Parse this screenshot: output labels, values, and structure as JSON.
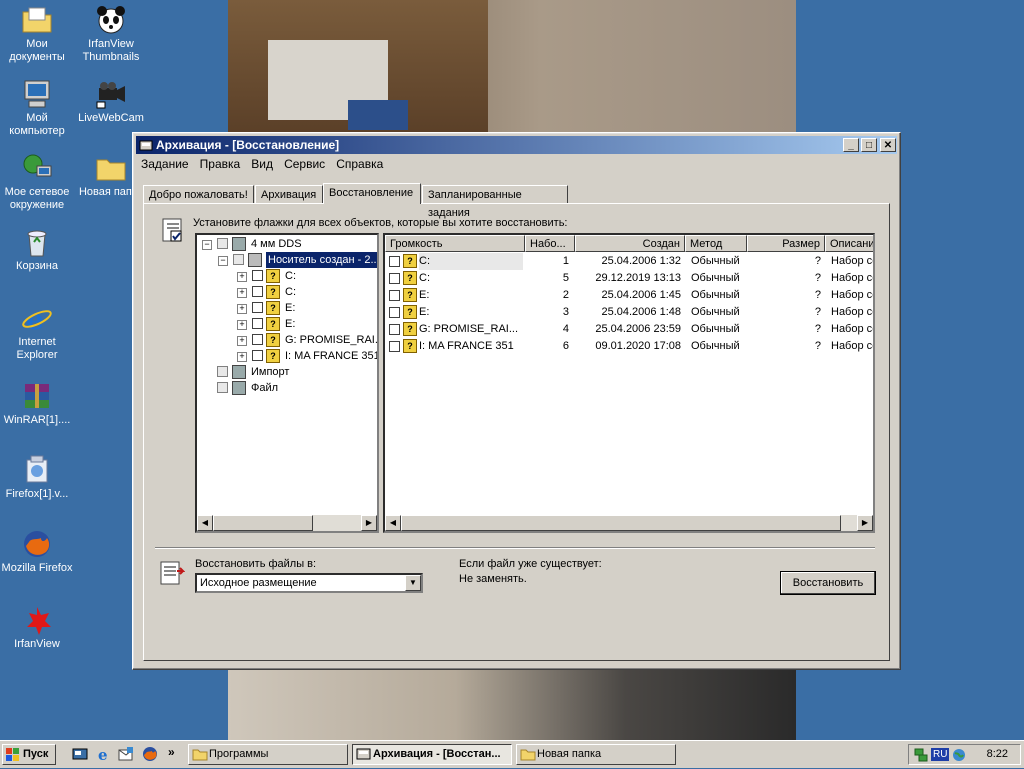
{
  "desktop": {
    "icons": [
      {
        "label": "Мои документы",
        "icon": "folder-documents-icon"
      },
      {
        "label": "IrfanView Thumbnails",
        "icon": "panda-icon"
      },
      {
        "label": "Мой компьютер",
        "icon": "computer-icon"
      },
      {
        "label": "LiveWebCam",
        "icon": "camera-icon"
      },
      {
        "label": "Мое сетевое окружение",
        "icon": "network-icon"
      },
      {
        "label": "Новая папка",
        "icon": "folder-icon"
      },
      {
        "label": "Корзина",
        "icon": "recycle-bin-icon"
      },
      {
        "label": "Internet Explorer",
        "icon": "ie-icon"
      },
      {
        "label": "WinRAR[1]....",
        "icon": "winrar-icon"
      },
      {
        "label": "Firefox[1].v...",
        "icon": "installer-icon"
      },
      {
        "label": "Mozilla Firefox",
        "icon": "firefox-icon"
      },
      {
        "label": "IrfanView",
        "icon": "irfanview-icon"
      }
    ]
  },
  "window": {
    "title": "Архивация - [Восстановление]",
    "menu": [
      "Задание",
      "Правка",
      "Вид",
      "Сервис",
      "Справка"
    ],
    "tabs": [
      "Добро пожаловать!",
      "Архивация",
      "Восстановление",
      "Запланированные задания"
    ],
    "active_tab": "Восстановление",
    "instruction": "Установите флажки для всех объектов, которые вы хотите восстановить:",
    "tree": [
      {
        "label": "4 мм DDS",
        "level": 0,
        "expand": "−",
        "type": "tape"
      },
      {
        "label": "Носитель создан - 2...",
        "level": 1,
        "expand": "−",
        "type": "media",
        "selected": true
      },
      {
        "label": "C:",
        "level": 2,
        "expand": "+",
        "type": "drive"
      },
      {
        "label": "C:",
        "level": 2,
        "expand": "+",
        "type": "drive"
      },
      {
        "label": "E:",
        "level": 2,
        "expand": "+",
        "type": "drive"
      },
      {
        "label": "E:",
        "level": 2,
        "expand": "+",
        "type": "drive"
      },
      {
        "label": "G: PROMISE_RAI...",
        "level": 2,
        "expand": "+",
        "type": "drive"
      },
      {
        "label": "I: MA FRANCE 351",
        "level": 2,
        "expand": "+",
        "type": "drive"
      },
      {
        "label": "Импорт",
        "level": 0,
        "expand": "",
        "type": "tape"
      },
      {
        "label": "Файл",
        "level": 0,
        "expand": "",
        "type": "tape"
      }
    ],
    "list": {
      "columns": [
        "Громкость",
        "Набо...",
        "Создан",
        "Метод",
        "Размер",
        "Описани"
      ],
      "rows": [
        [
          "C:",
          "1",
          "25.04.2006 1:32",
          "Обычный",
          "?",
          "Набор со"
        ],
        [
          "C:",
          "5",
          "29.12.2019 13:13",
          "Обычный",
          "?",
          "Набор со"
        ],
        [
          "E:",
          "2",
          "25.04.2006 1:45",
          "Обычный",
          "?",
          "Набор со"
        ],
        [
          "E:",
          "3",
          "25.04.2006 1:48",
          "Обычный",
          "?",
          "Набор со"
        ],
        [
          "G: PROMISE_RAI...",
          "4",
          "25.04.2006 23:59",
          "Обычный",
          "?",
          "Набор со"
        ],
        [
          "I: MA FRANCE 351",
          "6",
          "09.01.2020 17:08",
          "Обычный",
          "?",
          "Набор со"
        ]
      ]
    },
    "restore_to_label": "Восстановить файлы в:",
    "restore_to_value": "Исходное размещение",
    "if_exists_label": "Если файл уже существует:",
    "if_exists_value": "Не заменять.",
    "restore_button": "Восстановить"
  },
  "taskbar": {
    "start": "Пуск",
    "tasks": [
      {
        "label": "Программы",
        "active": false
      },
      {
        "label": "Архивация - [Восстан...",
        "active": true
      },
      {
        "label": "Новая папка",
        "active": false
      }
    ],
    "lang": "RU",
    "clock": "8:22",
    "more": "»"
  }
}
